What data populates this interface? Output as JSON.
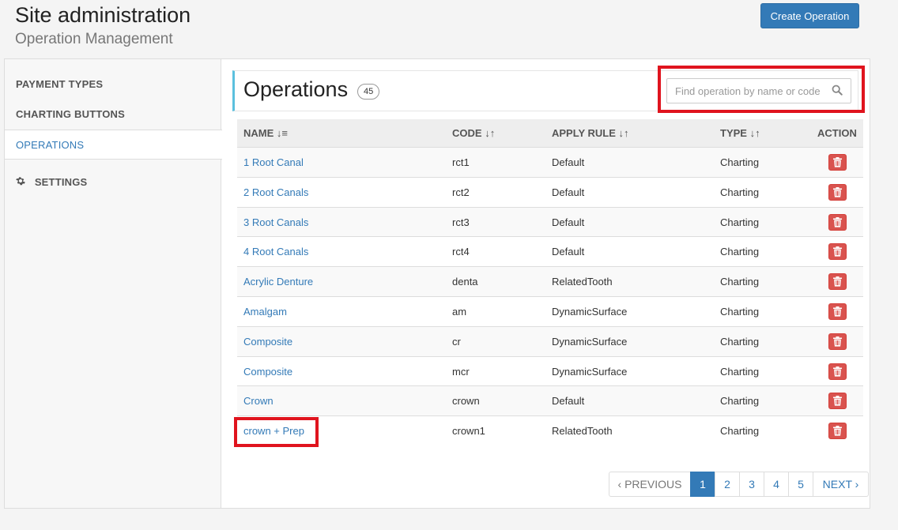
{
  "header": {
    "title": "Site administration",
    "subtitle": "Operation Management",
    "create_button": "Create Operation"
  },
  "sidebar": {
    "items": [
      {
        "label": "PAYMENT TYPES",
        "active": false
      },
      {
        "label": "CHARTING BUTTONS",
        "active": false
      },
      {
        "label": "OPERATIONS",
        "active": true
      },
      {
        "label": "SETTINGS",
        "active": false,
        "icon": "gear-icon"
      }
    ]
  },
  "operations": {
    "title": "Operations",
    "count": "45",
    "search_placeholder": "Find operation by name or code",
    "columns": {
      "name": "NAME",
      "code": "CODE",
      "apply_rule": "APPLY RULE",
      "type": "TYPE",
      "action": "ACTION"
    },
    "rows": [
      {
        "name": "1 Root Canal",
        "code": "rct1",
        "rule": "Default",
        "type": "Charting"
      },
      {
        "name": "2 Root Canals",
        "code": "rct2",
        "rule": "Default",
        "type": "Charting"
      },
      {
        "name": "3 Root Canals",
        "code": "rct3",
        "rule": "Default",
        "type": "Charting"
      },
      {
        "name": "4 Root Canals",
        "code": "rct4",
        "rule": "Default",
        "type": "Charting"
      },
      {
        "name": "Acrylic Denture",
        "code": "denta",
        "rule": "RelatedTooth",
        "type": "Charting"
      },
      {
        "name": "Amalgam",
        "code": "am",
        "rule": "DynamicSurface",
        "type": "Charting"
      },
      {
        "name": "Composite",
        "code": "cr",
        "rule": "DynamicSurface",
        "type": "Charting"
      },
      {
        "name": "Composite",
        "code": "mcr",
        "rule": "DynamicSurface",
        "type": "Charting"
      },
      {
        "name": "Crown",
        "code": "crown",
        "rule": "Default",
        "type": "Charting"
      },
      {
        "name": "crown + Prep",
        "code": "crown1",
        "rule": "RelatedTooth",
        "type": "Charting"
      }
    ]
  },
  "pagination": {
    "prev": "PREVIOUS",
    "pages": [
      "1",
      "2",
      "3",
      "4",
      "5"
    ],
    "current": "1",
    "next": "NEXT"
  },
  "colors": {
    "primary": "#337ab7",
    "danger": "#d9534f",
    "highlight": "#e0141e",
    "accent_border": "#5bc0de"
  }
}
